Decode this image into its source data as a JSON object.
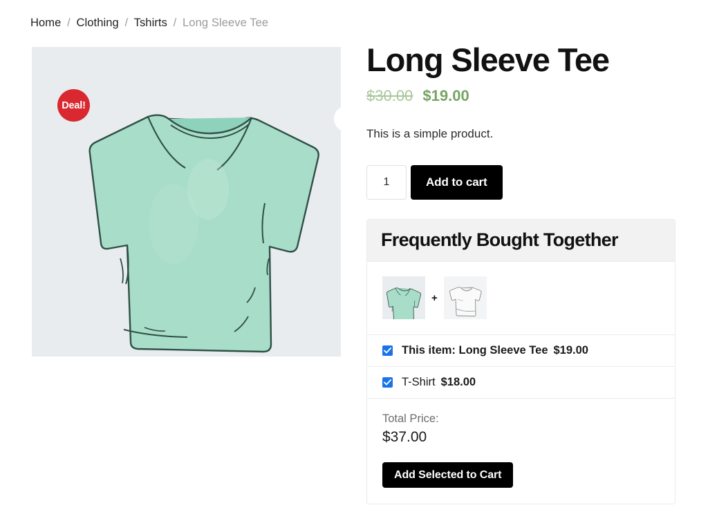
{
  "breadcrumb": {
    "items": [
      {
        "label": "Home",
        "current": false
      },
      {
        "label": "Clothing",
        "current": false
      },
      {
        "label": "Tshirts",
        "current": false
      },
      {
        "label": "Long Sleeve Tee",
        "current": true
      }
    ],
    "separator": "/"
  },
  "gallery": {
    "badge_label": "Deal!",
    "zoom_icon": "search-icon",
    "image_alt": "Long Sleeve Tee",
    "background_color": "#e8ecef",
    "badge_color": "#d9282f"
  },
  "product": {
    "title": "Long Sleeve Tee",
    "price_old": "$30.00",
    "price_new": "$19.00",
    "price_old_color": "#a9c89b",
    "price_new_color": "#77a464",
    "short_description": "This is a simple product.",
    "quantity_value": "1",
    "quantity_placeholder": "1",
    "add_to_cart_label": "Add to cart"
  },
  "fbt": {
    "heading": "Frequently Bought Together",
    "plus_symbol": "+",
    "thumbnails": [
      {
        "name": "Long Sleeve Tee",
        "style": "long-sleeve"
      },
      {
        "name": "T-Shirt",
        "style": "tshirt"
      }
    ],
    "items": [
      {
        "label": "This item: Long Sleeve Tee",
        "price": "$19.00",
        "checked": true,
        "bold": true
      },
      {
        "label": "T-Shirt",
        "price": "$18.00",
        "checked": true,
        "bold": false
      }
    ],
    "total_label": "Total Price:",
    "total_value": "$37.00",
    "add_selected_label": "Add Selected to Cart",
    "checkbox_color": "#1a73e8"
  }
}
